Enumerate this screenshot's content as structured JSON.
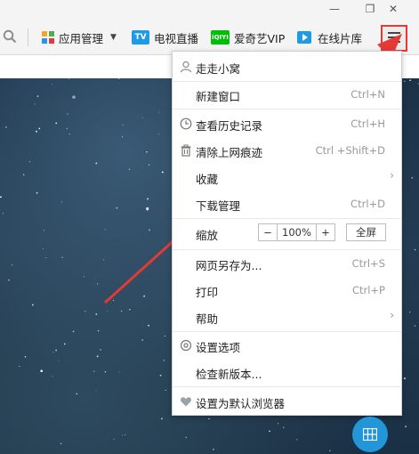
{
  "window": {
    "controls": {
      "minimize": "—",
      "restore": "❐",
      "close": "✕"
    }
  },
  "toolbar": {
    "search_icon": "search-icon",
    "items": [
      {
        "id": "app-manage",
        "label": "应用管理",
        "icon": "puzzle-icon",
        "has_dropdown": true
      },
      {
        "id": "tv-live",
        "label": "电视直播",
        "icon": "tv-icon"
      },
      {
        "id": "iqiyi",
        "label": "爱奇艺VIP",
        "icon": "iqiyi-icon",
        "icon_text": "iQIYI"
      },
      {
        "id": "video-library",
        "label": "在线片库",
        "icon": "film-icon"
      }
    ],
    "menu_button_icon": "hamburger-icon"
  },
  "menu": {
    "items": [
      {
        "label": "走走小窝",
        "icon": "user-icon"
      },
      {
        "label": "新建窗口",
        "shortcut": "Ctrl+N"
      },
      {
        "label": "查看历史记录",
        "icon": "clock-icon",
        "shortcut": "Ctrl+H"
      },
      {
        "label": "清除上网痕迹",
        "icon": "trash-icon",
        "shortcut": "Ctrl +Shift+D"
      },
      {
        "label": "收藏",
        "has_submenu": true
      },
      {
        "label": "下载管理",
        "shortcut": "Ctrl+D"
      },
      {
        "label": "网页另存为...",
        "shortcut": "Ctrl+S"
      },
      {
        "label": "打印",
        "shortcut": "Ctrl+P"
      },
      {
        "label": "帮助",
        "has_submenu": true
      },
      {
        "label": "设置选项",
        "icon": "gear-icon"
      },
      {
        "label": "检查新版本..."
      },
      {
        "label": "设置为默认浏览器",
        "icon": "heart-icon"
      }
    ],
    "zoom": {
      "label": "缩放",
      "minus": "−",
      "value": "100%",
      "plus": "+",
      "fullscreen": "全屏"
    }
  },
  "colors": {
    "highlight_red": "#e53935",
    "accent_blue": "#2196d9",
    "iqiyi_green": "#00be06",
    "tv_blue": "#1e9be3"
  }
}
